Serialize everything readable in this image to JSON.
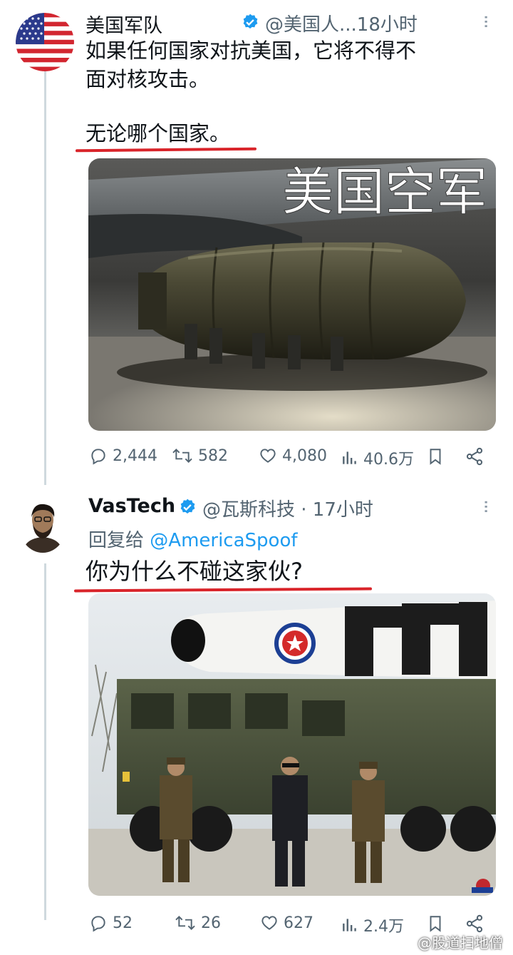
{
  "tweet1": {
    "author": "美国军队",
    "handle_time": "@美国人...18小时",
    "line1": "如果任何国家对抗美国，它将不得不",
    "line2": "面对核攻击。",
    "line3": "无论哪个国家。",
    "image_overlay_text": "美国空军",
    "replies": "2,444",
    "retweets": "582",
    "likes": "4,080",
    "views": "40.6万"
  },
  "tweet2": {
    "author": "VasTech",
    "handle_time": "@瓦斯科技 · 17小时",
    "reply_prefix": "回复给",
    "reply_handle": "@AmericaSpoof",
    "text": "你为什么不碰这家伙?",
    "replies": "52",
    "retweets": "26",
    "likes": "627",
    "views": "2.4万"
  },
  "watermark": "@股道扫地僧",
  "colors": {
    "verified": "#1d9bf0",
    "underline": "#d9242a",
    "meta": "#536471"
  },
  "icons": [
    "verified-badge-icon",
    "more-icon",
    "reply-icon",
    "retweet-icon",
    "like-icon",
    "views-icon",
    "bookmark-icon",
    "share-icon",
    "weibo-icon"
  ]
}
